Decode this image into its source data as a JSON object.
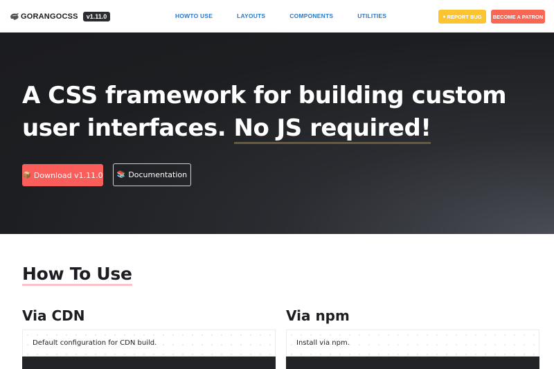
{
  "nav": {
    "brand": "GORANGOCSS",
    "version": "v1.11.0",
    "links": [
      "HOWTO USE",
      "LAYOUTS",
      "COMPONENTS",
      "UTILITIES"
    ],
    "report_bug": "REPORT BUG",
    "patron": "BECOME A PATRON"
  },
  "hero": {
    "title_part1": "A CSS framework for building custom user interfaces.",
    "title_highlight": "No JS required!",
    "download_label": "Download v1.11.0",
    "docs_label": "Documentation"
  },
  "how_to_use": {
    "title": "How To Use",
    "cdn": {
      "title": "Via CDN",
      "note": "Default configuration for CDN build."
    },
    "npm": {
      "title": "Via npm",
      "note": "Install via npm."
    }
  },
  "colors": {
    "accent_red": "#fa5e5b",
    "accent_yellow": "#fcc52f",
    "link_blue": "#2a78c9",
    "hero_dark": "#1d1e21"
  },
  "icons": {
    "brand": "gorilla-logo-icon",
    "download": "package-icon",
    "docs": "books-icon",
    "bug": "bug-icon"
  }
}
